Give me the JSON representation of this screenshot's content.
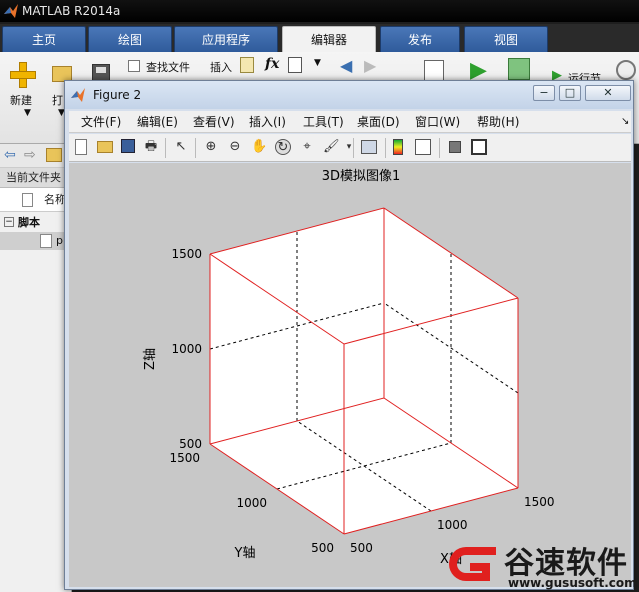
{
  "window": {
    "title": "MATLAB R2014a"
  },
  "ribbon_tabs": [
    "主页",
    "绘图",
    "应用程序",
    "编辑器",
    "发布",
    "视图"
  ],
  "ribbon": {
    "new_label": "新建",
    "open_label": "打",
    "find_files_label": "查找文件",
    "insert_label": "插入",
    "fx_label": "fx",
    "run_section_label": "运行节"
  },
  "file_browser": {
    "current_folder_label": "当前文件夹",
    "name_col_label": "名称",
    "group_label": "脚本",
    "file_item": "p"
  },
  "figure": {
    "title": "Figure 2",
    "menu": [
      "文件(F)",
      "编辑(E)",
      "查看(V)",
      "插入(I)",
      "工具(T)",
      "桌面(D)",
      "窗口(W)",
      "帮助(H)"
    ]
  },
  "chart_data": {
    "type": "3d-box",
    "title": "3D模拟图像1",
    "xlabel": "X轴",
    "ylabel": "Y轴",
    "zlabel": "Z轴",
    "xlim": [
      500,
      1500
    ],
    "ylim": [
      500,
      1500
    ],
    "zlim": [
      500,
      1500
    ],
    "x_ticks": [
      "500",
      "1000",
      "1500"
    ],
    "y_ticks": [
      "500",
      "1000",
      "1500"
    ],
    "z_ticks": [
      "500",
      "1000",
      "1500"
    ],
    "box_color": "#e02020",
    "grid": true
  },
  "watermark": {
    "text": "谷速软件",
    "url": "www.gususoft.com"
  }
}
